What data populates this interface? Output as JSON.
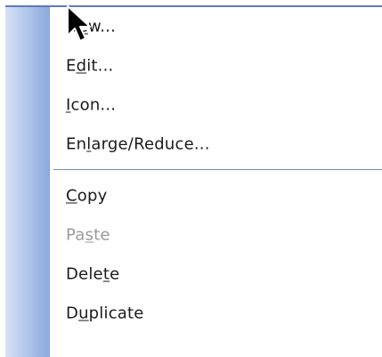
{
  "context_menu": {
    "items": [
      {
        "id": "new",
        "before": "N",
        "accel": "e",
        "after": "w...",
        "enabled": true
      },
      {
        "id": "edit",
        "before": "E",
        "accel": "d",
        "after": "it...",
        "enabled": true
      },
      {
        "id": "icon",
        "before": "",
        "accel": "I",
        "after": "con...",
        "enabled": true
      },
      {
        "id": "enlarge-reduce",
        "before": "En",
        "accel": "l",
        "after": "arge/Reduce...",
        "enabled": true
      },
      {
        "id": "separator"
      },
      {
        "id": "copy",
        "before": "",
        "accel": "C",
        "after": "opy",
        "enabled": true
      },
      {
        "id": "paste",
        "before": "Pa",
        "accel": "s",
        "after": "te",
        "enabled": false
      },
      {
        "id": "delete",
        "before": "Dele",
        "accel": "t",
        "after": "e",
        "enabled": true
      },
      {
        "id": "duplicate",
        "before": "D",
        "accel": "u",
        "after": "plicate",
        "enabled": true
      }
    ]
  },
  "cursor": {
    "icon": "arrow-pointer-icon"
  },
  "colors": {
    "menu_border": "#5b7bb5",
    "separator": "#6e8fc6",
    "gutter_light": "#d6e2f5",
    "gutter_dark": "#8aa8dc",
    "text": "#1a1a1a",
    "text_disabled": "#9a9a9a"
  }
}
